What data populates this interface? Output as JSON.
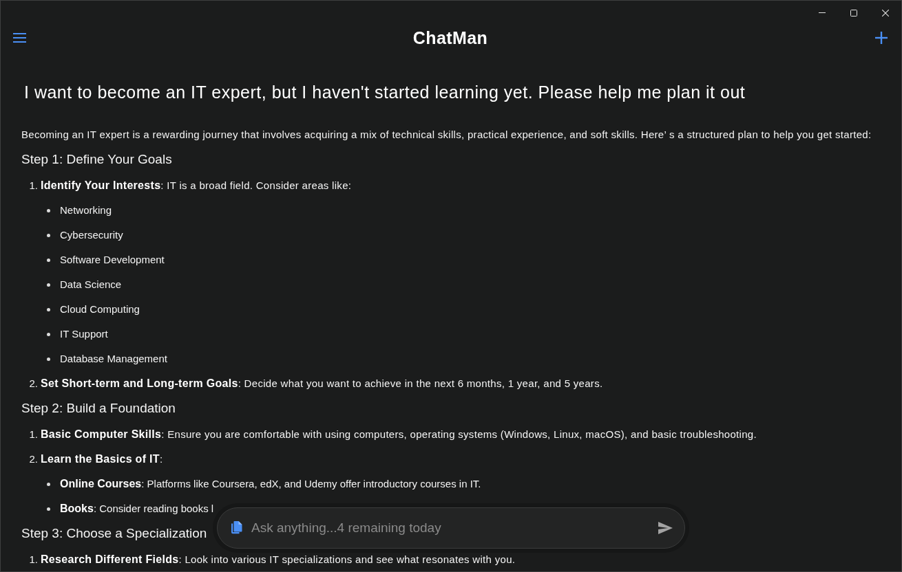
{
  "header": {
    "title": "ChatMan"
  },
  "chat": {
    "question": "I want to become an IT expert, but I haven't started learning yet. Please help me plan it out",
    "intro": "Becoming an IT expert is a rewarding journey that involves acquiring a mix of technical skills, practical experience, and soft skills. Here’ s a structured plan to help you get started:",
    "sections": [
      {
        "heading": "Step 1: Define Your Goals",
        "items": [
          {
            "number": "1.",
            "text": "**Identify Your Interests**: IT is a broad field. Consider areas like:",
            "sub_items": [
              "Networking",
              "Cybersecurity",
              "Software Development",
              "Data Science",
              "Cloud Computing",
              "IT Support",
              "Database Management"
            ]
          },
          {
            "number": "2.",
            "text": "**Set Short-term and Long-term Goals**: Decide what you want to achieve in the next 6 months, 1 year, and 5 years."
          }
        ]
      },
      {
        "heading": "Step 2: Build a Foundation",
        "items": [
          {
            "number": "1.",
            "text": "**Basic Computer Skills**: Ensure you are comfortable with using computers, operating systems (Windows, Linux, macOS), and basic troubleshooting."
          },
          {
            "number": "2.",
            "text": "**Learn the Basics of IT**:",
            "sub_items": [
              "**Online Courses**: Platforms like Coursera, edX, and Udemy offer introductory courses in IT.",
              "**Books**: Consider reading books l"
            ]
          }
        ]
      },
      {
        "heading": "Step 3: Choose a Specialization",
        "items": [
          {
            "number": "1.",
            "text": "**Research Different Fields**: Look into various IT specializations and see what resonates with you."
          }
        ]
      }
    ]
  },
  "composer": {
    "placeholder": "Ask anything...4 remaining today"
  }
}
